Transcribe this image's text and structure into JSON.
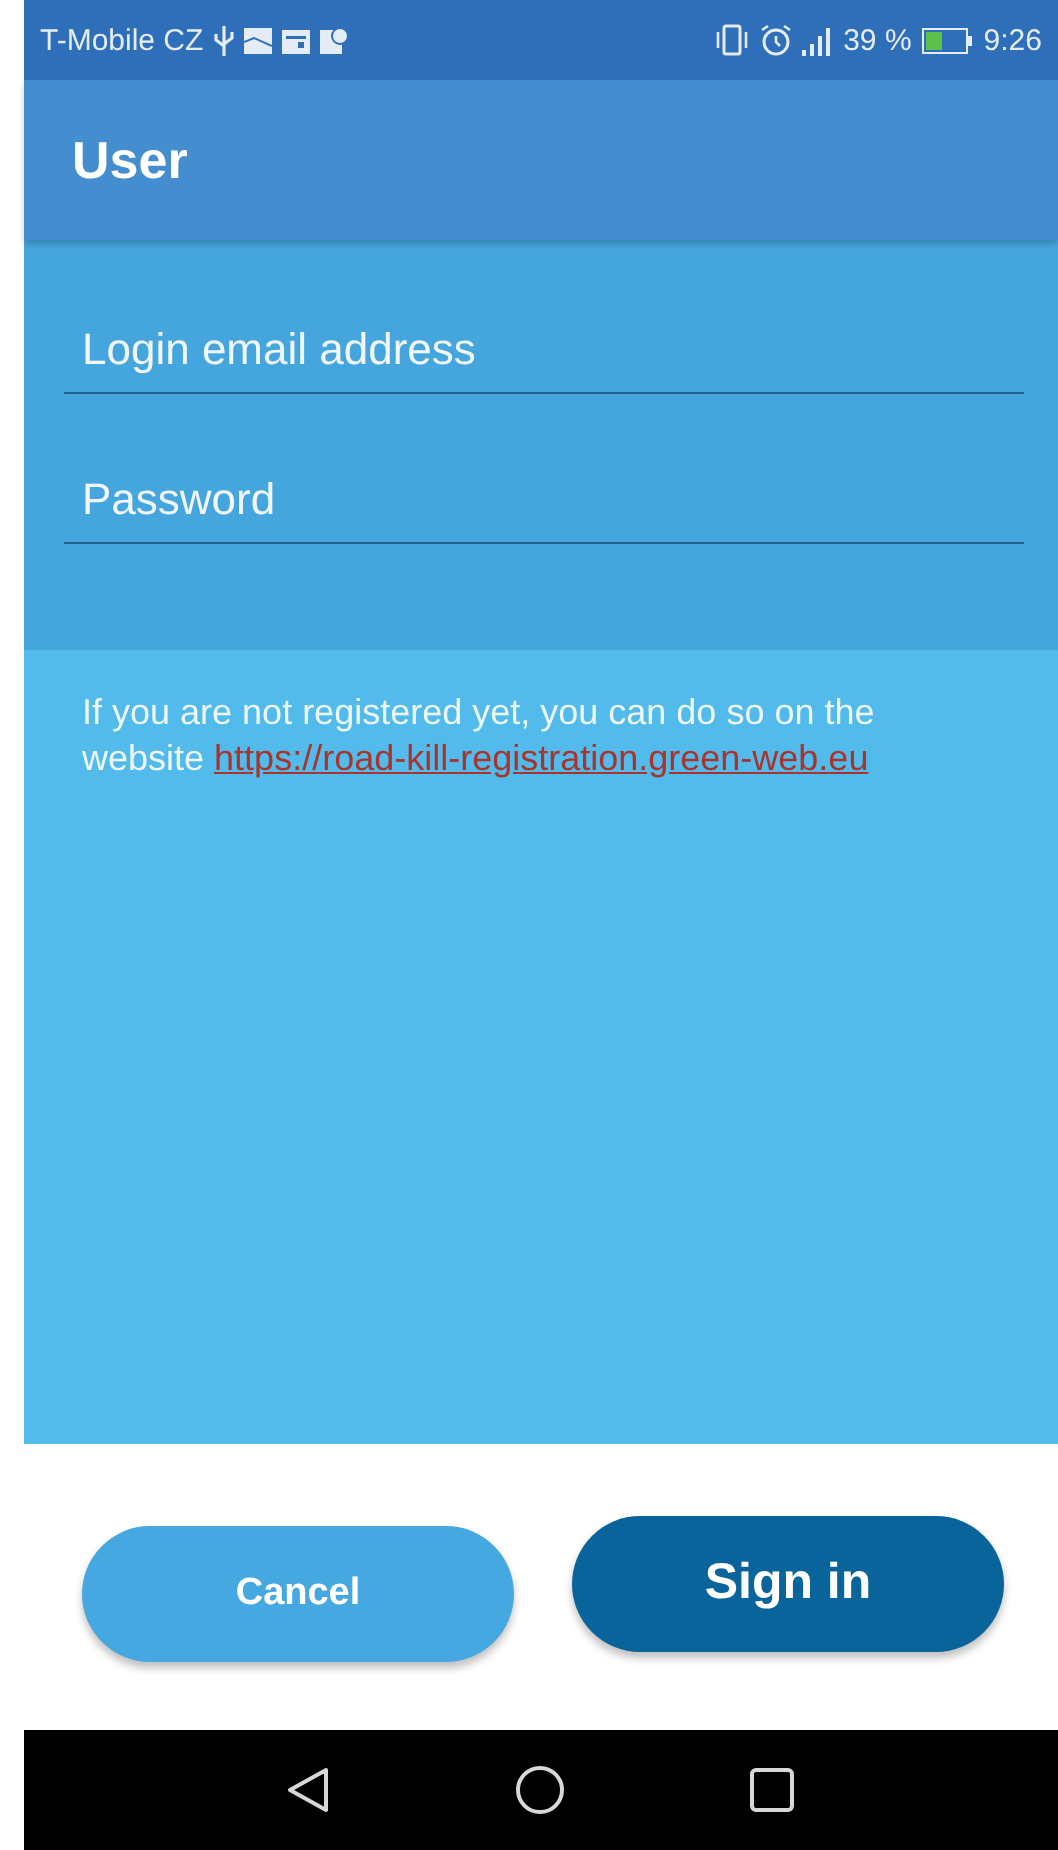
{
  "status_bar": {
    "carrier": "T-Mobile CZ",
    "battery": "39 %",
    "time": "9:26"
  },
  "app_bar": {
    "title": "User"
  },
  "form": {
    "fields": [
      {
        "placeholder": "Login email address"
      },
      {
        "placeholder": "Password"
      }
    ]
  },
  "info": {
    "text": "If you are not registered yet, you can do so on the website",
    "link": "https://road-kill-registration.green-web.eu"
  },
  "buttons": [
    {
      "label": "Cancel",
      "kind": "secondary"
    },
    {
      "label": "Sign in",
      "kind": "primary"
    }
  ]
}
